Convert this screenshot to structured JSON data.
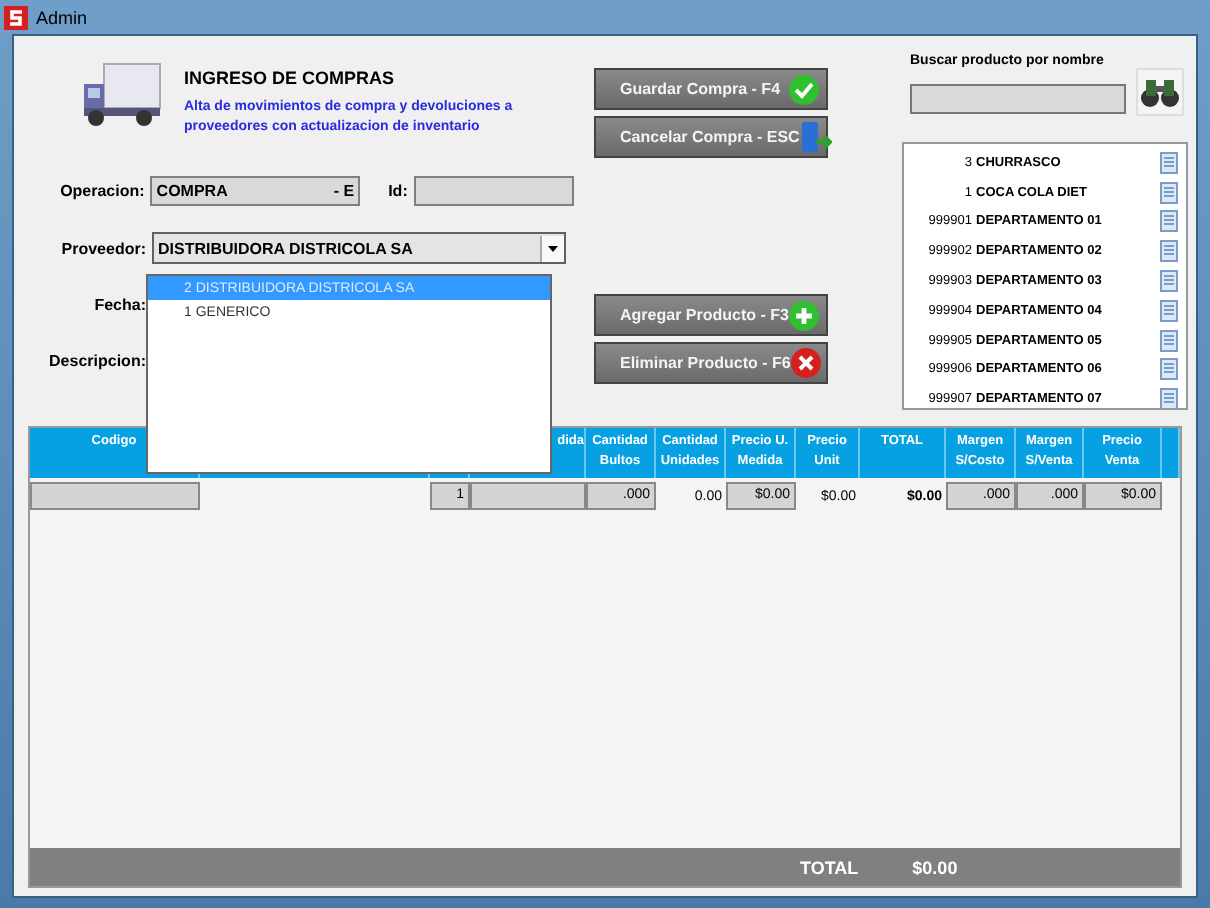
{
  "window": {
    "title": "Admin"
  },
  "header": {
    "title": "INGRESO DE COMPRAS",
    "subtitle": "Alta de movimientos de compra y devoluciones a proveedores con actualizacion de inventario"
  },
  "form": {
    "operacion": {
      "label": "Operacion:",
      "value": "COMPRA",
      "suffix": "- E"
    },
    "id": {
      "label": "Id:"
    },
    "proveedor": {
      "label": "Proveedor:",
      "value": "DISTRIBUIDORA DISTRICOLA  SA",
      "expanded": true,
      "options": [
        {
          "label": "2 DISTRIBUIDORA DISTRICOLA  SA",
          "selected": true
        },
        {
          "label": "1 GENERICO",
          "selected": false
        }
      ]
    },
    "fecha": {
      "label": "Fecha:"
    },
    "descripcion": {
      "label": "Descripcion:"
    }
  },
  "actions": [
    {
      "label": "Guardar Compra - F4",
      "kind": "save"
    },
    {
      "label": "Cancelar Compra - ESC",
      "kind": "cancel"
    },
    {
      "label": "Agregar Producto - F3",
      "kind": "add"
    },
    {
      "label": "Eliminar Producto - F6",
      "kind": "delete"
    }
  ],
  "search": {
    "label": "Buscar producto por nombre"
  },
  "products": [
    {
      "code": "3",
      "name": "CHURRASCO"
    },
    {
      "code": "1",
      "name": "COCA COLA DIET"
    },
    {
      "code": "999901",
      "name": "DEPARTAMENTO 01"
    },
    {
      "code": "999902",
      "name": "DEPARTAMENTO 02"
    },
    {
      "code": "999903",
      "name": "DEPARTAMENTO 03"
    },
    {
      "code": "999904",
      "name": "DEPARTAMENTO 04"
    },
    {
      "code": "999905",
      "name": "DEPARTAMENTO 05"
    },
    {
      "code": "999906",
      "name": "DEPARTAMENTO 06"
    },
    {
      "code": "999907",
      "name": "DEPARTAMENTO 07"
    }
  ],
  "table": {
    "columns": [
      {
        "label": "Codigo"
      },
      {
        "kind": "blank"
      },
      {
        "kind": "blank"
      },
      {
        "label": "dida",
        "kind": "cut"
      },
      {
        "label": "Cantidad Bultos"
      },
      {
        "label": "Cantidad Unidades"
      },
      {
        "label": "Precio U. Medida"
      },
      {
        "label": "Precio Unit"
      },
      {
        "label": "TOTAL"
      },
      {
        "label": "Margen S/Costo"
      },
      {
        "label": "Margen S/Venta"
      },
      {
        "label": "Precio Venta"
      },
      {
        "kind": "blank"
      }
    ],
    "row": [
      {
        "kind": "field"
      },
      {
        "kind": "blank"
      },
      {
        "kind": "field",
        "value": "1"
      },
      {
        "kind": "field"
      },
      {
        "kind": "field",
        "value": ".000"
      },
      {
        "kind": "text",
        "value": "0.00"
      },
      {
        "kind": "field",
        "value": "$0.00"
      },
      {
        "kind": "text",
        "value": "$0.00"
      },
      {
        "kind": "bold",
        "value": "$0.00"
      },
      {
        "kind": "field",
        "value": ".000"
      },
      {
        "kind": "field",
        "value": ".000"
      },
      {
        "kind": "field",
        "value": "$0.00"
      },
      {
        "kind": "blank"
      }
    ]
  },
  "footer": {
    "label": "TOTAL",
    "value": "$0.00"
  }
}
